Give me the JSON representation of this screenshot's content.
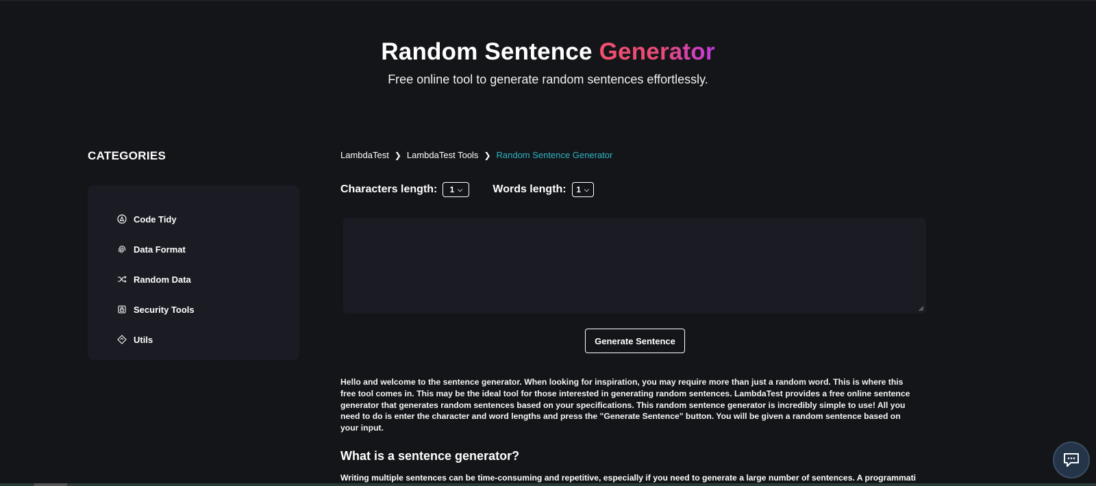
{
  "hero": {
    "title_main": "Random Sentence",
    "title_accent": "Generator",
    "subtitle": "Free online tool to generate random sentences effortlessly."
  },
  "sidebar": {
    "title": "CATEGORIES",
    "items": [
      {
        "label": "Code Tidy",
        "icon": "code-tidy-icon"
      },
      {
        "label": "Data Format",
        "icon": "fingerprint-icon"
      },
      {
        "label": "Random Data",
        "icon": "shuffle-icon"
      },
      {
        "label": "Security Tools",
        "icon": "lock-icon"
      },
      {
        "label": "Utils",
        "icon": "diamond-icon"
      }
    ]
  },
  "breadcrumb": [
    "LambdaTest",
    "LambdaTest Tools",
    "Random Sentence Generator"
  ],
  "controls": {
    "chars_label": "Characters length:",
    "chars_value": "1",
    "words_label": "Words length:",
    "words_value": "1"
  },
  "output": {
    "value": ""
  },
  "generate_button": "Generate Sentence",
  "intro_text": "Hello and welcome to the sentence generator. When looking for inspiration, you may require more than just a random word. This is where this free tool comes in. This may be the ideal tool for those interested in generating random sentences. LambdaTest provides a free online sentence generator that generates random sentences based on your specifications. This random sentence generator is incredibly simple to use! All you need to do is enter the character and word lengths and press the \"Generate Sentence\" button. You will be given a random sentence based on your input.",
  "section_heading": "What is a sentence generator?",
  "section_text": "Writing multiple sentences can be time-consuming and repetitive, especially if you need to generate a large number of sentences. A programmatic",
  "colors": {
    "background": "#141518",
    "panel": "#1b1c23",
    "accent_link": "#2fb5c4",
    "gradient_start": "#f0506e",
    "gradient_end": "#c03ae0"
  }
}
